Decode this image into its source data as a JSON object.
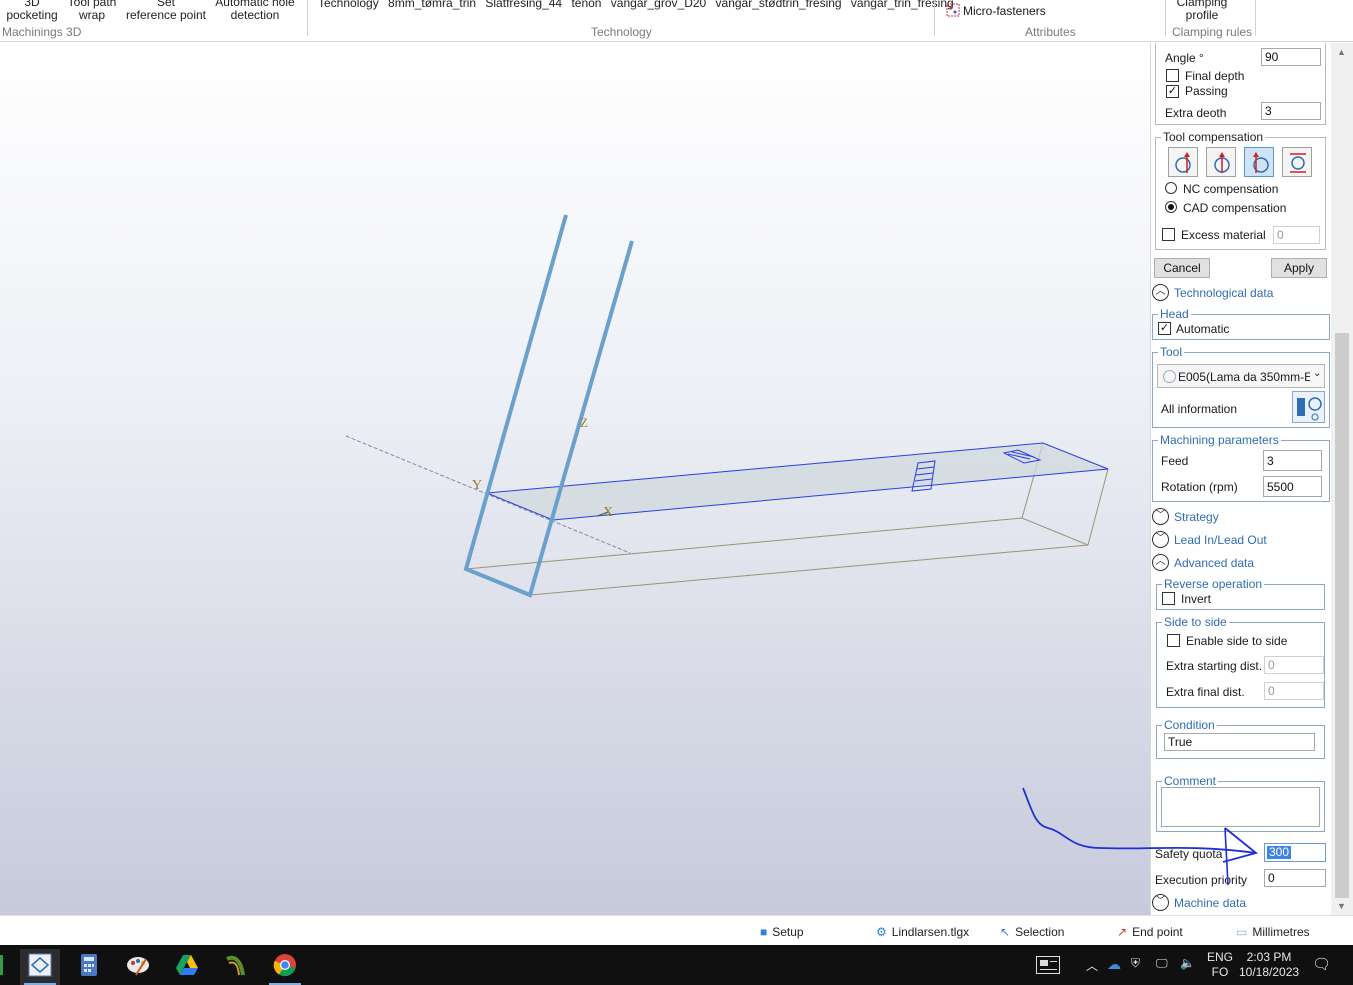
{
  "ribbon": {
    "buttons": [
      {
        "line1": "3D",
        "line2": "pocketing"
      },
      {
        "line1": "Tool path",
        "line2": "wrap"
      },
      {
        "line1": "Set",
        "line2": "reference point"
      },
      {
        "line1": "Automatic hole",
        "line2": "detection"
      }
    ],
    "group_machinings": "Machinings 3D",
    "technology_items": "Technology  8mm_tømra_trin  Slatfresing_44  tenon  vangar_grov_D20  vangar_stødtrin_fresing  vangar_trin_fresing",
    "group_technology": "Technology",
    "micro_fasteners": "Micro-fasteners",
    "group_attributes": "Attributes",
    "clamping_line1": "Clamping",
    "clamping_line2": "profile",
    "group_clamping": "Clamping rules"
  },
  "viewport": {
    "axis_z": "Z",
    "axis_y": "Y",
    "axis_x": "X"
  },
  "panel": {
    "angle_label": "Angle °",
    "angle_value": "90",
    "final_depth_label": "Final depth",
    "final_depth_checked": false,
    "passing_label": "Passing",
    "passing_checked": true,
    "extra_depth_label": "Extra deoth",
    "extra_depth_value": "3",
    "tool_compensation_title": "Tool compensation",
    "nc_compensation": "NC compensation",
    "cad_compensation": "CAD compensation",
    "excess_material_label": "Excess material",
    "excess_material_value": "0",
    "cancel": "Cancel",
    "apply": "Apply",
    "technological_data": "Technological data",
    "head_title": "Head",
    "automatic_label": "Automatic",
    "tool_title": "Tool",
    "tool_value": "E005(Lama da 350mm-E",
    "all_information": "All information",
    "machining_params_title": "Machining parameters",
    "feed_label": "Feed",
    "feed_value": "3",
    "rotation_label": "Rotation (rpm)",
    "rotation_value": "5500",
    "strategy": "Strategy",
    "lead_in_out": "Lead In/Lead Out",
    "advanced_data": "Advanced data",
    "reverse_operation_title": "Reverse operation",
    "invert_label": "Invert",
    "side_to_side_title": "Side to side",
    "enable_side_label": "Enable side to side",
    "extra_starting_label": "Extra starting dist.",
    "extra_starting_value": "0",
    "extra_final_label": "Extra final dist.",
    "extra_final_value": "0",
    "condition_title": "Condition",
    "condition_value": "True",
    "comment_title": "Comment",
    "comment_value": "",
    "safety_quota_label": "Safety quota",
    "safety_quota_value": "300",
    "execution_priority_label": "Execution priority",
    "execution_priority_value": "0",
    "machine_data": "Machine data"
  },
  "status": {
    "setup": "Setup",
    "file": "Lindlarsen.tlgx",
    "selection": "Selection",
    "end_point": "End point",
    "units": "Millimetres"
  },
  "taskbar": {
    "lang_top": "ENG",
    "lang_bottom": "FO",
    "time": "2:03 PM",
    "date": "10/18/2023"
  },
  "colors": {
    "accent_blue": "#2f6db5",
    "annotation_blue": "#1f2fd8",
    "taskbar": "#101010"
  }
}
